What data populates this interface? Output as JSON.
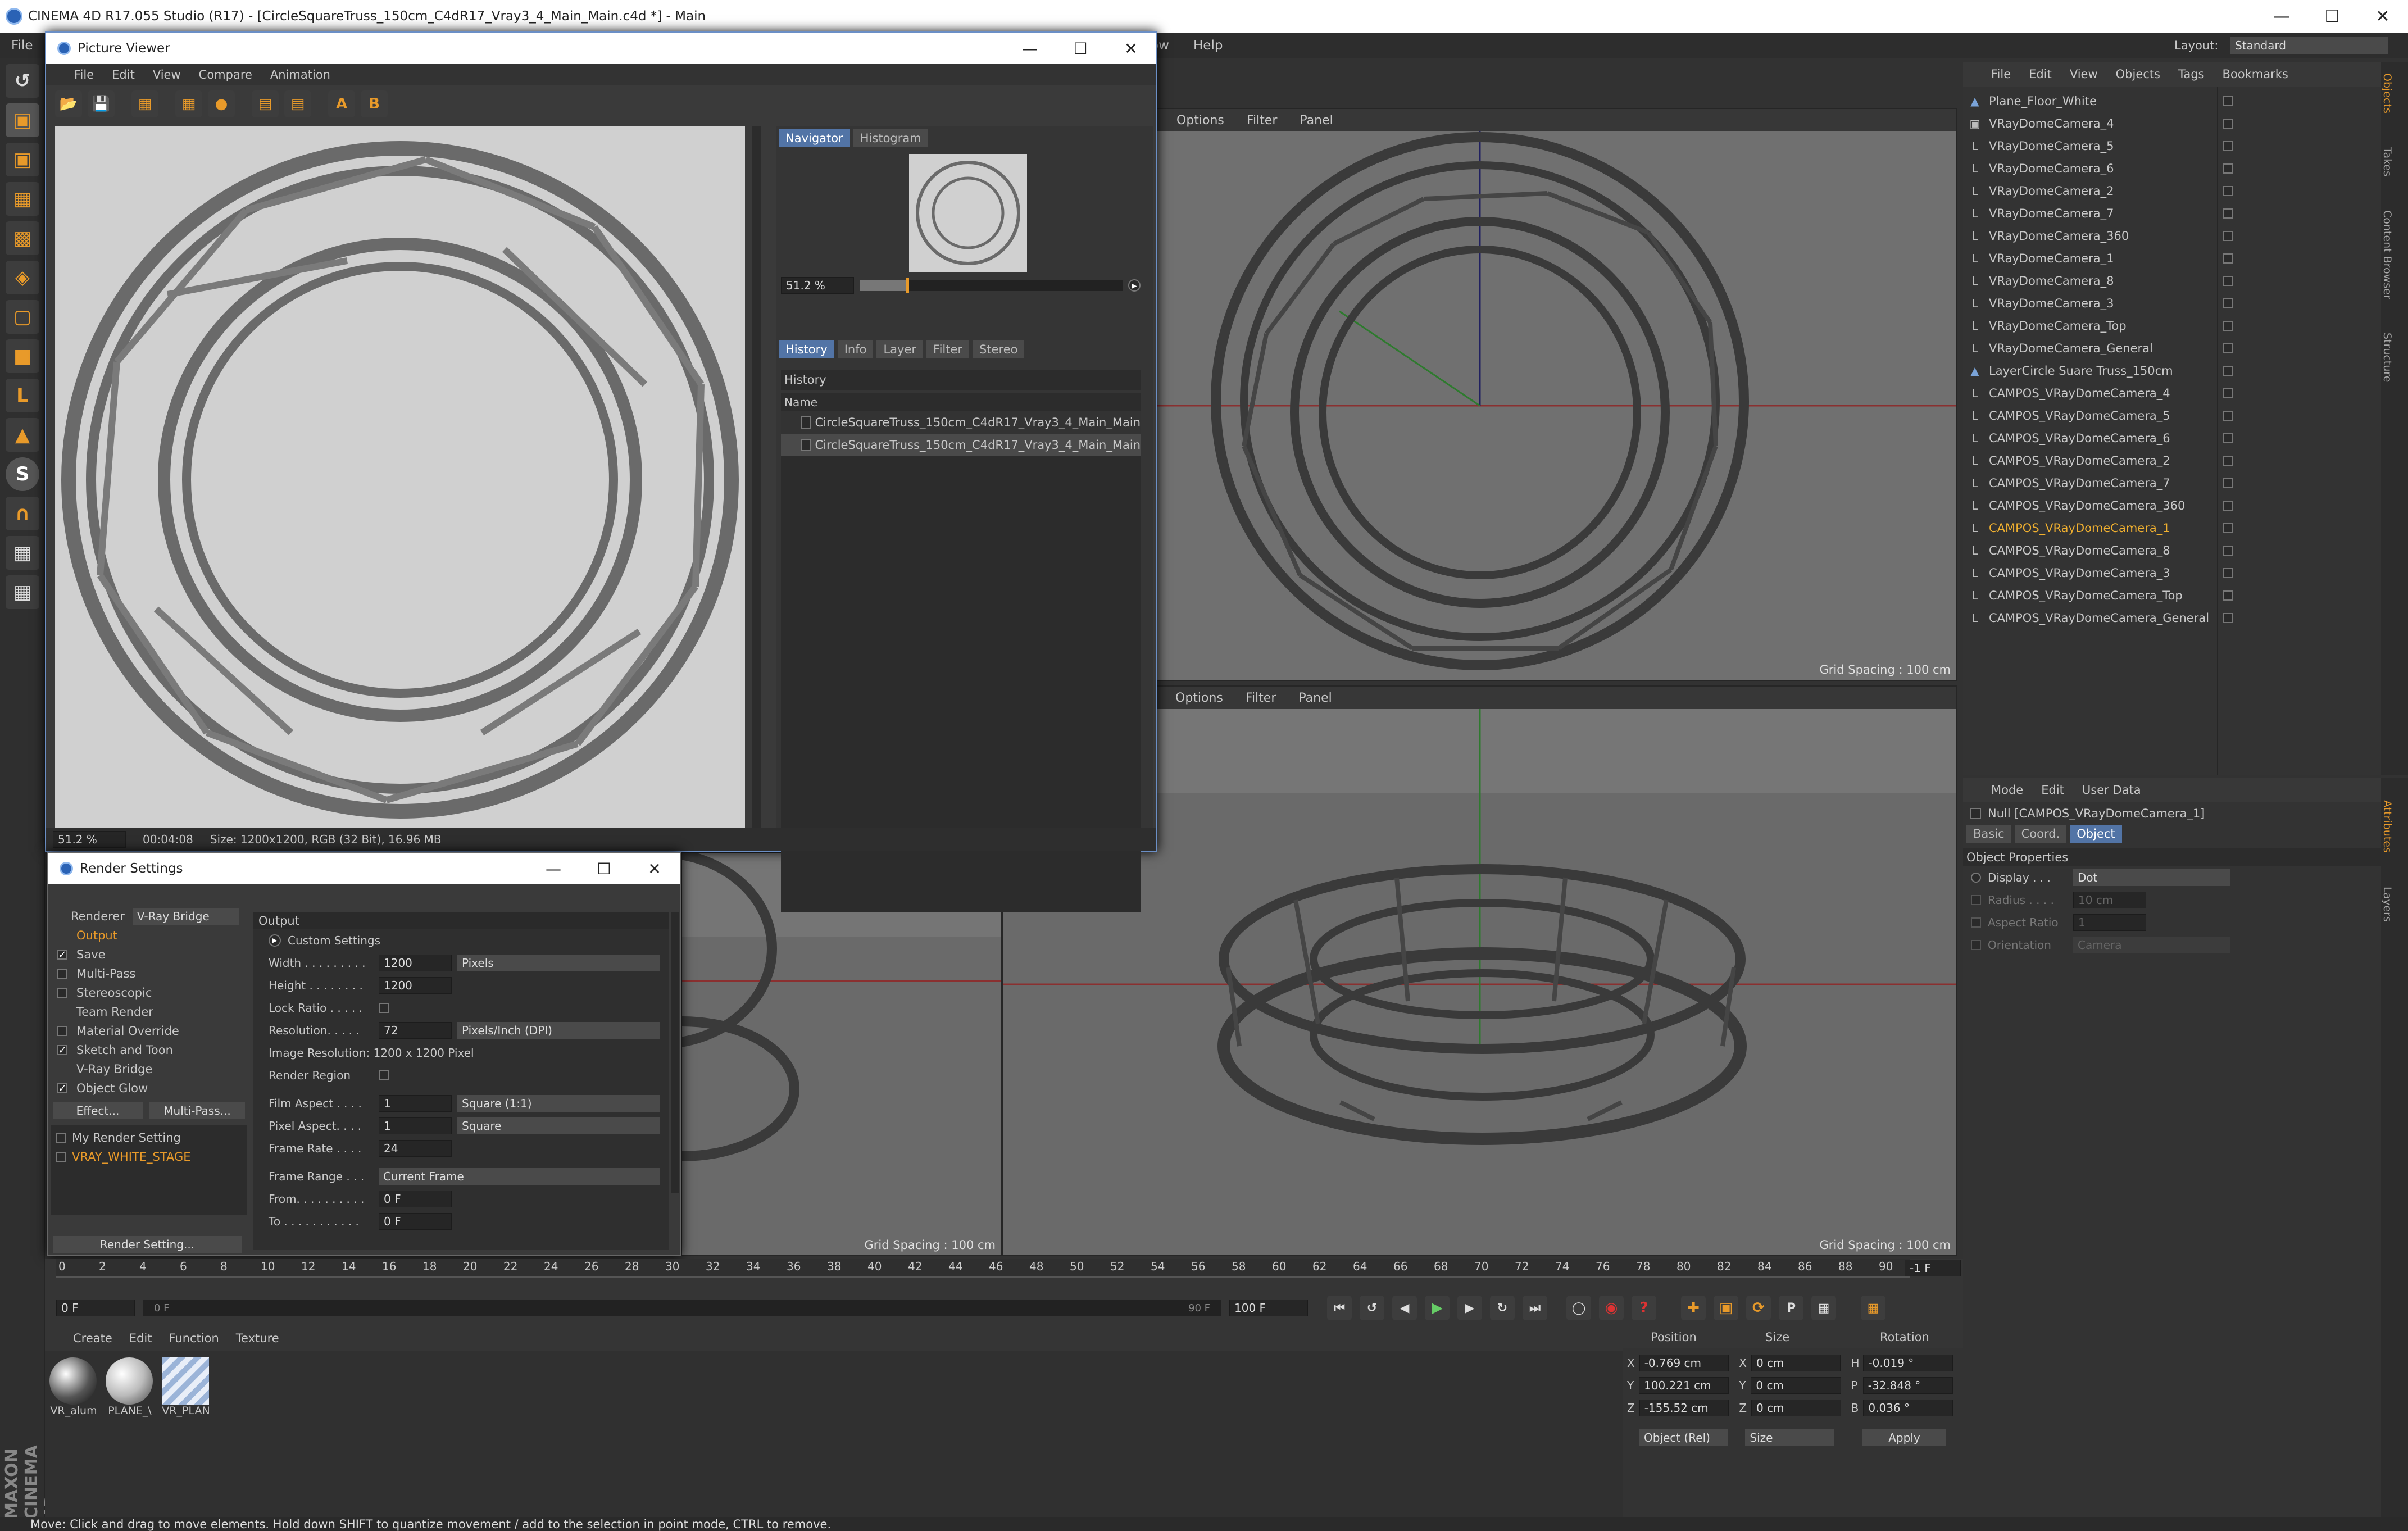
{
  "app": {
    "title": "CINEMA 4D R17.055 Studio (R17) - [CircleSquareTruss_150cm_C4dR17_Vray3_4_Main_Main.c4d *] - Main",
    "menu": [
      "File"
    ],
    "menu_right": [
      "ow",
      "Help"
    ],
    "layout_label": "Layout:",
    "layout_value": "Standard"
  },
  "picture_viewer": {
    "title": "Picture Viewer",
    "menu": [
      "File",
      "Edit",
      "View",
      "Compare",
      "Animation"
    ],
    "nav_tabs": [
      "Navigator",
      "Histogram"
    ],
    "zoom": "51.2 %",
    "hist_tabs": [
      "History",
      "Info",
      "Layer",
      "Filter",
      "Stereo"
    ],
    "history_heading": "History",
    "name_col": "Name",
    "history_items": [
      "CircleSquareTruss_150cm_C4dR17_Vray3_4_Main_Main",
      "CircleSquareTruss_150cm_C4dR17_Vray3_4_Main_Main"
    ],
    "status_zoom": "51.2 %",
    "status_time": "00:04:08",
    "status_size": "Size: 1200x1200, RGB (32 Bit), 16.96 MB"
  },
  "viewports": {
    "menu": [
      "Options",
      "Filter",
      "Panel"
    ],
    "grid_spacing": "Grid Spacing : 100 cm"
  },
  "render_settings": {
    "title": "Render Settings",
    "renderer_label": "Renderer",
    "renderer_value": "V-Ray Bridge",
    "left_items": [
      {
        "label": "Output",
        "checked": null,
        "active": true
      },
      {
        "label": "Save",
        "checked": true
      },
      {
        "label": "Multi-Pass",
        "checked": false
      },
      {
        "label": "Stereoscopic",
        "checked": false
      },
      {
        "label": "Team Render",
        "checked": null
      },
      {
        "label": "Material Override",
        "checked": false
      },
      {
        "label": "Sketch and Toon",
        "checked": true
      },
      {
        "label": "V-Ray Bridge",
        "checked": null
      },
      {
        "label": "Object Glow",
        "checked": true
      }
    ],
    "effect_btn": "Effect...",
    "multipass_btn": "Multi-Pass...",
    "settings_list": [
      "My Render Setting",
      "VRAY_WHITE_STAGE"
    ],
    "render_setting_btn": "Render Setting...",
    "output_heading": "Output",
    "custom_settings": "Custom Settings",
    "fields": {
      "width_label": "Width . . . . . . . . .",
      "width_value": "1200",
      "width_unit": "Pixels",
      "height_label": "Height  . . . . . . . .",
      "height_value": "1200",
      "lockratio_label": "Lock Ratio . . . . .",
      "resolution_label": "Resolution. . . . .",
      "resolution_value": "72",
      "resolution_unit": "Pixels/Inch (DPI)",
      "image_res": "Image Resolution: 1200 x 1200 Pixel",
      "render_region": "Render Region",
      "film_aspect_label": "Film Aspect . . . .",
      "film_aspect_value": "1",
      "film_aspect_unit": "Square (1:1)",
      "pixel_aspect_label": "Pixel Aspect. . . .",
      "pixel_aspect_value": "1",
      "pixel_aspect_unit": "Square",
      "frame_rate_label": "Frame Rate . . . .",
      "frame_rate_value": "24",
      "frame_range_label": "Frame Range . . .",
      "frame_range_value": "Current Frame",
      "from_label": "From. . . . . . . . . .",
      "from_value": "0 F",
      "to_label": "To . . . . . . . . . . .",
      "to_value": "0 F"
    }
  },
  "objects": {
    "menu": [
      "File",
      "Edit",
      "View",
      "Objects",
      "Tags",
      "Bookmarks"
    ],
    "items": [
      {
        "name": "Plane_Floor_White",
        "type": "plane",
        "selected": false
      },
      {
        "name": "VRayDomeCamera_4",
        "type": "camera",
        "selected": false
      },
      {
        "name": "VRayDomeCamera_5",
        "type": "null",
        "selected": false
      },
      {
        "name": "VRayDomeCamera_6",
        "type": "null",
        "selected": false
      },
      {
        "name": "VRayDomeCamera_2",
        "type": "null",
        "selected": false
      },
      {
        "name": "VRayDomeCamera_7",
        "type": "null",
        "selected": false
      },
      {
        "name": "VRayDomeCamera_360",
        "type": "null",
        "selected": false
      },
      {
        "name": "VRayDomeCamera_1",
        "type": "null",
        "selected": false
      },
      {
        "name": "VRayDomeCamera_8",
        "type": "null",
        "selected": false
      },
      {
        "name": "VRayDomeCamera_3",
        "type": "null",
        "selected": false
      },
      {
        "name": "VRayDomeCamera_Top",
        "type": "null",
        "selected": false
      },
      {
        "name": "VRayDomeCamera_General",
        "type": "null",
        "selected": false
      },
      {
        "name": "LayerCircle Suare Truss_150cm",
        "type": "layer",
        "selected": false
      },
      {
        "name": "CAMPOS_VRayDomeCamera_4",
        "type": "null",
        "selected": false
      },
      {
        "name": "CAMPOS_VRayDomeCamera_5",
        "type": "null",
        "selected": false
      },
      {
        "name": "CAMPOS_VRayDomeCamera_6",
        "type": "null",
        "selected": false
      },
      {
        "name": "CAMPOS_VRayDomeCamera_2",
        "type": "null",
        "selected": false
      },
      {
        "name": "CAMPOS_VRayDomeCamera_7",
        "type": "null",
        "selected": false
      },
      {
        "name": "CAMPOS_VRayDomeCamera_360",
        "type": "null",
        "selected": false
      },
      {
        "name": "CAMPOS_VRayDomeCamera_1",
        "type": "null",
        "selected": true
      },
      {
        "name": "CAMPOS_VRayDomeCamera_8",
        "type": "null",
        "selected": false
      },
      {
        "name": "CAMPOS_VRayDomeCamera_3",
        "type": "null",
        "selected": false
      },
      {
        "name": "CAMPOS_VRayDomeCamera_Top",
        "type": "null",
        "selected": false
      },
      {
        "name": "CAMPOS_VRayDomeCamera_General",
        "type": "null",
        "selected": false
      }
    ]
  },
  "attributes": {
    "menu": [
      "Mode",
      "Edit",
      "User Data"
    ],
    "object_name": "Null [CAMPOS_VRayDomeCamera_1]",
    "tabs": [
      "Basic",
      "Coord.",
      "Object"
    ],
    "section": "Object Properties",
    "display_label": "Display . . .",
    "display_value": "Dot",
    "radius_label": "Radius . . . .",
    "radius_value": "10 cm",
    "aspect_label": "Aspect Ratio",
    "aspect_value": "1",
    "orientation_label": "Orientation",
    "orientation_value": "Camera"
  },
  "timeline": {
    "ticks": [
      "0",
      "2",
      "4",
      "6",
      "8",
      "10",
      "12",
      "14",
      "16",
      "18",
      "20",
      "22",
      "24",
      "26",
      "28",
      "30",
      "32",
      "34",
      "36",
      "38",
      "40",
      "42",
      "44",
      "46",
      "48",
      "50",
      "52",
      "54",
      "56",
      "58",
      "60",
      "62",
      "64",
      "66",
      "68",
      "70",
      "72",
      "74",
      "76",
      "78",
      "80",
      "82",
      "84",
      "86",
      "88",
      "90"
    ],
    "frame_field": "-1 F",
    "start": "0 F",
    "slider_start": "0 F",
    "slider_end": "90 F",
    "end": "100 F"
  },
  "materials": {
    "menu": [
      "Create",
      "Edit",
      "Function",
      "Texture"
    ],
    "items": [
      "VR_alum",
      "PLANE_\\",
      "VR_PLAN"
    ]
  },
  "coordinates": {
    "headers": [
      "Position",
      "Size",
      "Rotation"
    ],
    "rows": [
      {
        "axis": "X",
        "pos": "-0.769 cm",
        "saxis": "X",
        "size": "0 cm",
        "raxis": "H",
        "rot": "-0.019 °"
      },
      {
        "axis": "Y",
        "pos": "100.221 cm",
        "saxis": "Y",
        "size": "0 cm",
        "raxis": "P",
        "rot": "-32.848 °"
      },
      {
        "axis": "Z",
        "pos": "-155.52 cm",
        "saxis": "Z",
        "size": "0 cm",
        "raxis": "B",
        "rot": "0.036 °"
      }
    ],
    "mode": "Object (Rel)",
    "size_mode": "Size",
    "apply": "Apply"
  },
  "status": "Move: Click and drag to move elements. Hold down SHIFT to quantize movement / add to the selection in point mode, CTRL to remove.",
  "side_tabs": [
    "Objects",
    "Takes",
    "Content Browser",
    "Structure"
  ],
  "side_tabs2": [
    "Attributes",
    "Layers"
  ],
  "brand": "MAXON CINEMA 4D"
}
